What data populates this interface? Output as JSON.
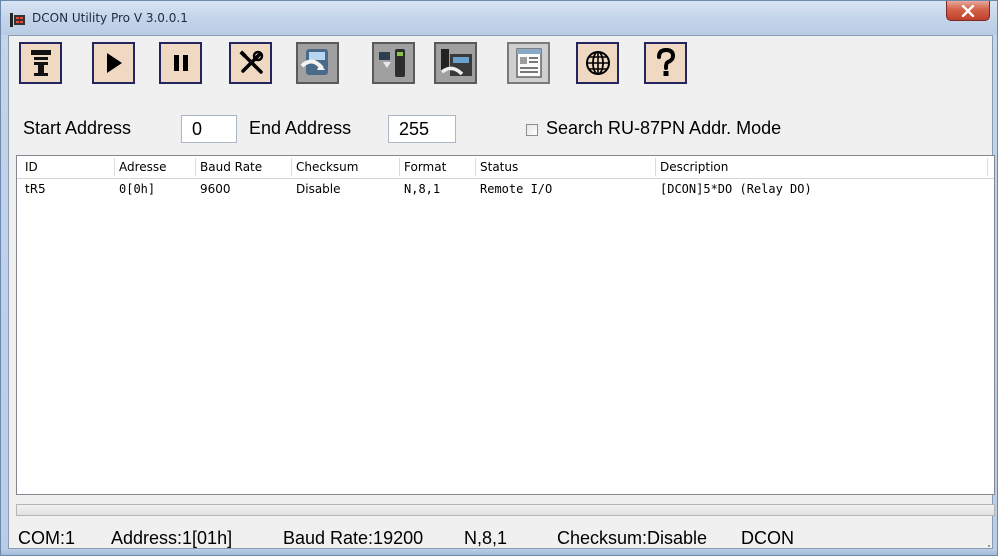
{
  "window": {
    "title": "DCON Utility Pro V 3.0.0.1"
  },
  "toolbar": {
    "buttons": [
      {
        "name": "com-port-settings",
        "icon": "serial-port-icon"
      },
      {
        "name": "start-search",
        "icon": "play-icon"
      },
      {
        "name": "stop-search",
        "icon": "pause-icon"
      },
      {
        "name": "tools",
        "icon": "tools-icon"
      },
      {
        "name": "module-backup",
        "icon": "module-transfer-icon"
      },
      {
        "name": "firmware-update",
        "icon": "firmware-icon"
      },
      {
        "name": "io-module",
        "icon": "io-module-icon"
      },
      {
        "name": "terminal",
        "icon": "terminal-window-icon"
      },
      {
        "name": "language",
        "icon": "globe-icon"
      },
      {
        "name": "help",
        "icon": "question-icon"
      }
    ]
  },
  "address": {
    "start_label": "Start Address",
    "start_value": "0",
    "end_label": "End Address",
    "end_value": "255",
    "search_mode_label": "Search RU-87PN Addr. Mode",
    "search_mode_checked": false
  },
  "table": {
    "columns": [
      "ID",
      "Adresse",
      "Baud Rate",
      "Checksum",
      "Format",
      "Status",
      "Description"
    ],
    "rows": [
      [
        "tR5",
        "0[0h]",
        "9600",
        "Disable",
        "N,8,1",
        "Remote I/O",
        "[DCON]5*DO (Relay DO)"
      ]
    ]
  },
  "status": {
    "com": "COM:1",
    "address": "Address:1[01h]",
    "baud": "Baud Rate:19200",
    "format": "N,8,1",
    "checksum": "Checksum:Disable",
    "protocol": "DCON"
  },
  "colors": {
    "button_fill": "#f0d9c3",
    "button_border": "#24245e",
    "close_button": "#c0402b"
  }
}
